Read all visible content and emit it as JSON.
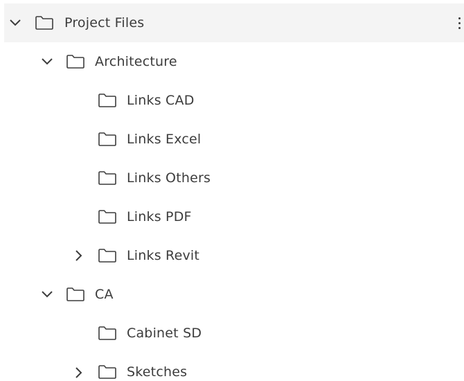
{
  "tree": {
    "root": {
      "label": "Project Files",
      "expanded": true,
      "selected": true,
      "more_icon": "vertical-dots-icon"
    },
    "architecture": {
      "label": "Architecture",
      "expanded": true,
      "children": [
        {
          "label": "Links CAD",
          "has_children": false
        },
        {
          "label": "Links Excel",
          "has_children": false
        },
        {
          "label": "Links Others",
          "has_children": false
        },
        {
          "label": "Links PDF",
          "has_children": false
        },
        {
          "label": "Links Revit",
          "has_children": true,
          "expanded": false
        }
      ]
    },
    "ca": {
      "label": "CA",
      "expanded": true,
      "children": [
        {
          "label": "Cabinet SD",
          "has_children": false
        },
        {
          "label": "Sketches",
          "has_children": true,
          "expanded": false
        }
      ]
    }
  },
  "colors": {
    "text": "#3c3c3c",
    "selected_bg": "#f4f4f4"
  }
}
